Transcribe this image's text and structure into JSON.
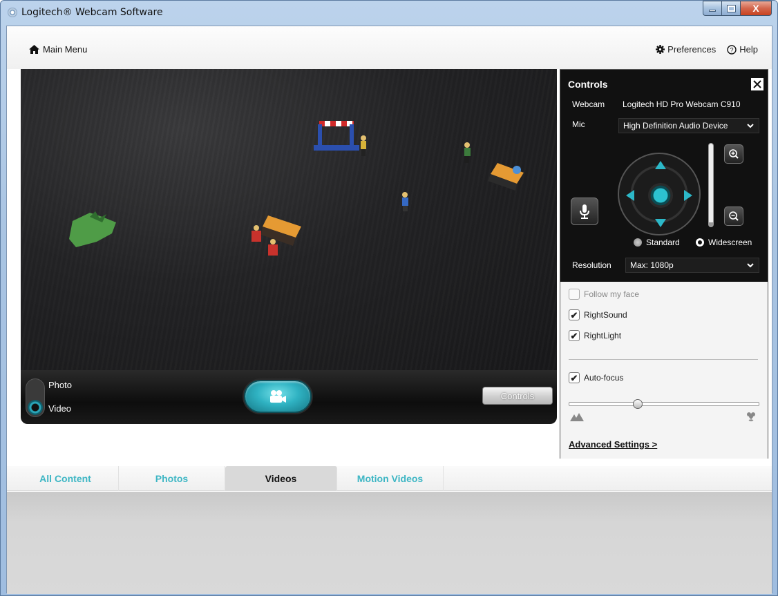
{
  "window": {
    "title": "Logitech® Webcam Software",
    "close_glyph": "X"
  },
  "topbar": {
    "main_menu": "Main Menu",
    "preferences": "Preferences",
    "help": "Help"
  },
  "capture": {
    "mode_photo": "Photo",
    "mode_video": "Video",
    "controls_button": "Controls",
    "selected_mode": "Video"
  },
  "controls": {
    "title": "Controls",
    "webcam_label": "Webcam",
    "webcam_value": "Logitech HD Pro Webcam C910",
    "mic_label": "Mic",
    "mic_value": "High Definition Audio Device",
    "zoom_level": 0.05,
    "aspect_standard": "Standard",
    "aspect_widescreen": "Widescreen",
    "aspect_selected": "Widescreen",
    "resolution_label": "Resolution",
    "resolution_value": "Max: 1080p",
    "follow_face": "Follow my face",
    "follow_face_checked": false,
    "right_sound": "RightSound",
    "right_sound_checked": true,
    "right_light": "RightLight",
    "right_light_checked": true,
    "auto_focus": "Auto-focus",
    "auto_focus_checked": true,
    "focus_level": 0.36,
    "advanced": "Advanced Settings >"
  },
  "tabs": [
    {
      "label": "All Content",
      "active": false
    },
    {
      "label": "Photos",
      "active": false
    },
    {
      "label": "Videos",
      "active": true
    },
    {
      "label": "Motion Videos",
      "active": false
    }
  ],
  "colors": {
    "accent": "#3db6c4",
    "panel_bg": "#111111"
  },
  "icons": {
    "main_menu": "home-icon",
    "preferences": "gear-icon",
    "help": "help-circle-icon",
    "record": "video-camera-icon",
    "mic": "microphone-icon",
    "zoom_in": "zoom-in-icon",
    "zoom_out": "zoom-out-icon",
    "focus_far": "mountains-icon",
    "focus_near": "flower-icon"
  }
}
